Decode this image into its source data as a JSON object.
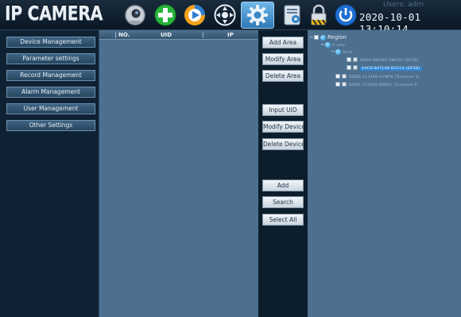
{
  "header": {
    "logo": "IP CAMERA",
    "user_text": "Users: adm",
    "datetime": "2020-10-01 13:10:14",
    "toolbar_icons": [
      "live-view-camera-icon",
      "add-green-icon",
      "playback-icon",
      "ptz-control-icon",
      "settings-gear-icon",
      "device-config-icon",
      "lock-icon",
      "power-logout-icon"
    ]
  },
  "sidebar": {
    "items": [
      {
        "label": "Device Management"
      },
      {
        "label": "Parameter settings"
      },
      {
        "label": "Record Management"
      },
      {
        "label": "Alarm Management"
      },
      {
        "label": "User Management"
      },
      {
        "label": "Other Settings"
      }
    ]
  },
  "device_table": {
    "columns": [
      "NO.",
      "UID",
      "IP"
    ],
    "rows": []
  },
  "actions": {
    "add_area": "Add Area",
    "modify_area": "Modify Area",
    "delete_area": "Delete Area",
    "input_uid": "Input UID",
    "modify_device": "Modify Device",
    "delete_device": "Delete Device",
    "add": "Add",
    "search": "Search",
    "select_all": "Select All"
  },
  "tree": {
    "root": "Region",
    "nodes": [
      {
        "label": "H.ome"
      },
      {
        "label": "Tesla"
      },
      {
        "label": "SDAA-094365-AWFDC (DFSD)"
      },
      {
        "label": "AACD-847148-DCCCA (DFSD)"
      },
      {
        "label": "DDDD-113368-GVWFK (Turtuned 1)"
      },
      {
        "label": "DDDA-757460-DDEEE (Turtuned 2)"
      }
    ]
  },
  "colors": {
    "panel_blue": "#4d7090",
    "dark_bg": "#0c1d2c",
    "selected_blue": "#2e86d6"
  }
}
